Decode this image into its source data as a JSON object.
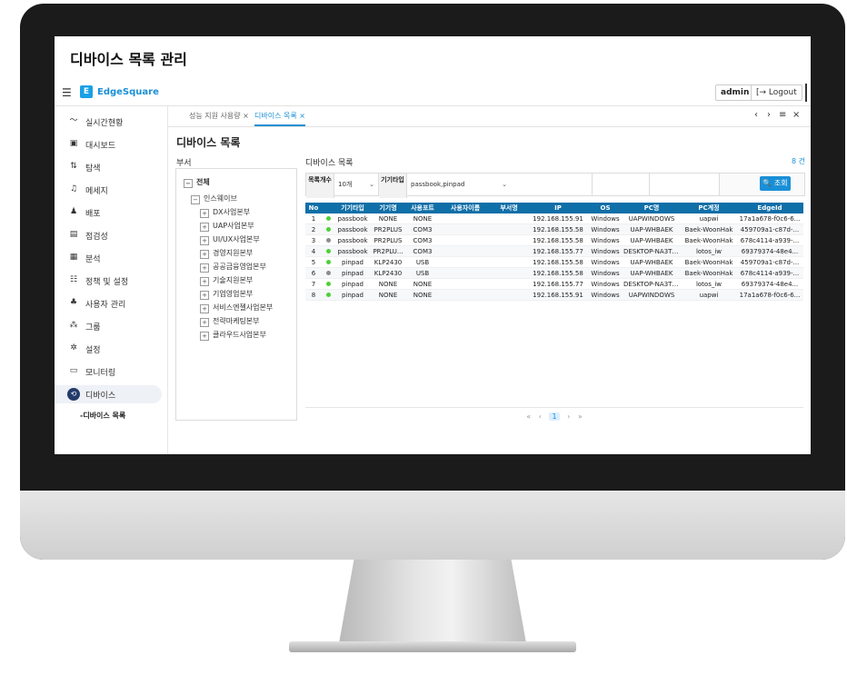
{
  "window_title": "디바이스 목록 관리",
  "header": {
    "menu_icon": "menu-icon",
    "logo_mark": "E",
    "logo_text": "EdgeSquare",
    "admin_label": "admin",
    "logout_label": "[→ Logout"
  },
  "sidebar": {
    "items": [
      {
        "label": "실시간현황",
        "icon": "chart-line-icon",
        "glyph": "〜"
      },
      {
        "label": "대시보드",
        "icon": "dashboard-icon",
        "glyph": "▣"
      },
      {
        "label": "탐색",
        "icon": "explore-icon",
        "glyph": "⇅"
      },
      {
        "label": "메세지",
        "icon": "bell-icon",
        "glyph": "♫"
      },
      {
        "label": "배포",
        "icon": "deploy-icon",
        "glyph": "♟"
      },
      {
        "label": "점검성",
        "icon": "monitor-icon",
        "glyph": "▤"
      },
      {
        "label": "분석",
        "icon": "analysis-icon",
        "glyph": "▦"
      },
      {
        "label": "정책 및 설정",
        "icon": "policy-icon",
        "glyph": "☷"
      },
      {
        "label": "사용자 관리",
        "icon": "users-icon",
        "glyph": "♣"
      },
      {
        "label": "그룹",
        "icon": "group-icon",
        "glyph": "⁂"
      },
      {
        "label": "설정",
        "icon": "settings-icon",
        "glyph": "✲"
      },
      {
        "label": "모니터링",
        "icon": "monitoring-icon",
        "glyph": "▭"
      },
      {
        "label": "디바이스",
        "icon": "device-icon",
        "glyph": "⟲"
      }
    ],
    "sub_item": "-디바이스 목록"
  },
  "tabs": [
    {
      "label": "성능 지원 사용량 ×"
    },
    {
      "label": "디바이스 목록 ×"
    }
  ],
  "tab_controls": {
    "prev": "‹",
    "next": "›",
    "menu": "≡",
    "close": "×"
  },
  "page": {
    "title": "디바이스 목록",
    "star": "☆",
    "dept_label": "부서",
    "list_label": "디바이스 목록",
    "count_label": "8 건"
  },
  "tree": [
    {
      "sign": "−",
      "label": "전체"
    },
    {
      "sign": "−",
      "label": "인스웨이브"
    },
    {
      "sign": "+",
      "label": "DX사업본부"
    },
    {
      "sign": "+",
      "label": "UAP사업본부"
    },
    {
      "sign": "+",
      "label": "UI/UX사업본부"
    },
    {
      "sign": "+",
      "label": "경영지원본부"
    },
    {
      "sign": "+",
      "label": "공공금융영업본부"
    },
    {
      "sign": "+",
      "label": "기술지원본부"
    },
    {
      "sign": "+",
      "label": "기업영업본부"
    },
    {
      "sign": "+",
      "label": "서비스엔젤사업본부"
    },
    {
      "sign": "+",
      "label": "전략마케팅본부"
    },
    {
      "sign": "+",
      "label": "클라우드사업본부"
    }
  ],
  "filter": {
    "count_key": "목록개수",
    "count_value": "10개",
    "type_key": "기기타입",
    "type_value": "passbook,pinpad",
    "chevron": "⌄",
    "search_label": "🔍 조회"
  },
  "table": {
    "columns": [
      "No",
      "",
      "기기타입",
      "기기명",
      "사용포트",
      "사용자이름",
      "부서명",
      "IP",
      "OS",
      "PC명",
      "PC계정",
      "EdgeId"
    ],
    "rows": [
      {
        "no": "1",
        "status": "#4cd137",
        "type": "passbook",
        "name": "NONE",
        "port": "NONE",
        "user": "",
        "dept": "",
        "ip": "192.168.155.91",
        "os": "Windows",
        "pc": "UAPWINDOWS",
        "account": "uapwi",
        "edge": "17a1a678-f0c6-6..."
      },
      {
        "no": "2",
        "status": "#4cd137",
        "type": "passbook",
        "name": "PR2PLUS",
        "port": "COM3",
        "user": "",
        "dept": "",
        "ip": "192.168.155.58",
        "os": "Windows",
        "pc": "UAP-WHBAEK",
        "account": "Baek-WoonHak",
        "edge": "459709a1-c87d-..."
      },
      {
        "no": "3",
        "status": "#8c8c8c",
        "type": "passbook",
        "name": "PR2PLUS",
        "port": "COM3",
        "user": "",
        "dept": "",
        "ip": "192.168.155.58",
        "os": "Windows",
        "pc": "UAP-WHBAEK",
        "account": "Baek-WoonHak",
        "edge": "678c4114-a939-..."
      },
      {
        "no": "4",
        "status": "#4cd137",
        "type": "passbook",
        "name": "PR2PLU...",
        "port": "COM3",
        "user": "",
        "dept": "",
        "ip": "192.168.155.77",
        "os": "Windows",
        "pc": "DESKTOP-NA3T4...",
        "account": "lotos_iw",
        "edge": "69379374-48e4..."
      },
      {
        "no": "5",
        "status": "#4cd137",
        "type": "pinpad",
        "name": "KLP2430",
        "port": "USB",
        "user": "",
        "dept": "",
        "ip": "192.168.155.58",
        "os": "Windows",
        "pc": "UAP-WHBAEK",
        "account": "Baek-WoonHak",
        "edge": "459709a1-c87d-..."
      },
      {
        "no": "6",
        "status": "#8c8c8c",
        "type": "pinpad",
        "name": "KLP2430",
        "port": "USB",
        "user": "",
        "dept": "",
        "ip": "192.168.155.58",
        "os": "Windows",
        "pc": "UAP-WHBAEK",
        "account": "Baek-WoonHak",
        "edge": "678c4114-a939-..."
      },
      {
        "no": "7",
        "status": "#4cd137",
        "type": "pinpad",
        "name": "NONE",
        "port": "NONE",
        "user": "",
        "dept": "",
        "ip": "192.168.155.77",
        "os": "Windows",
        "pc": "DESKTOP-NA3T4...",
        "account": "lotos_iw",
        "edge": "69379374-48e4..."
      },
      {
        "no": "8",
        "status": "#4cd137",
        "type": "pinpad",
        "name": "NONE",
        "port": "NONE",
        "user": "",
        "dept": "",
        "ip": "192.168.155.91",
        "os": "Windows",
        "pc": "UAPWINDOWS",
        "account": "uapwi",
        "edge": "17a1a678-f0c6-6..."
      }
    ]
  },
  "pager": {
    "first": "«",
    "prev": "‹",
    "current": "1",
    "next": "›",
    "last": "»"
  },
  "colors": {
    "accent": "#1a8fd6",
    "table_header": "#0f6fa8",
    "online": "#4cd137",
    "offline": "#8c8c8c"
  }
}
